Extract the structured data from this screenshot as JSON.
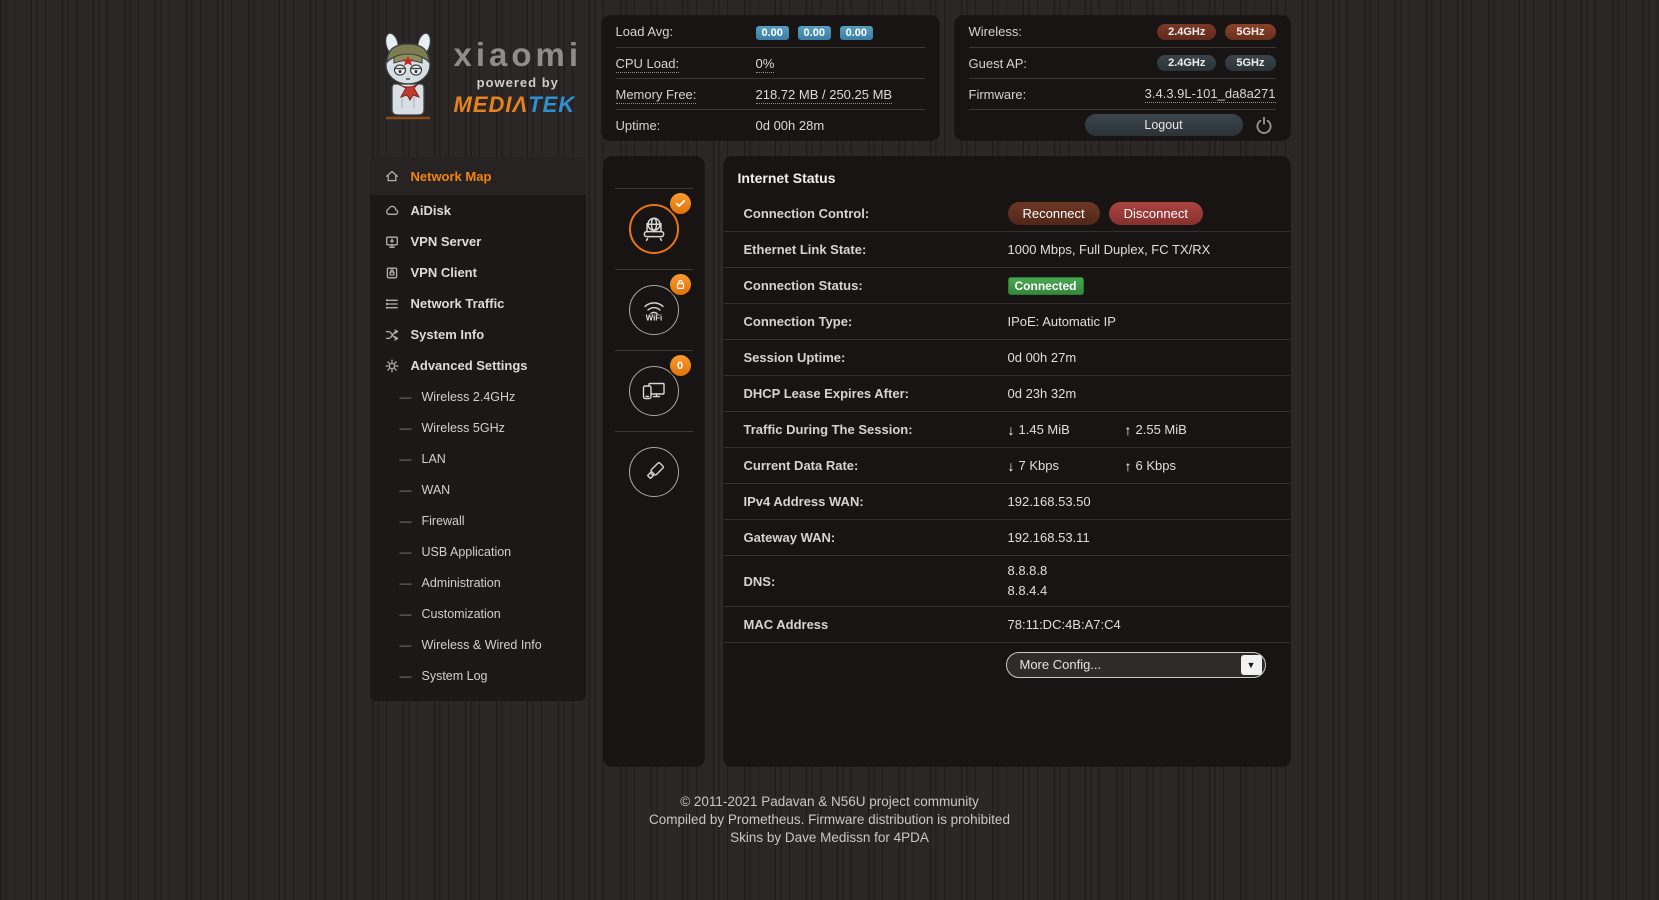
{
  "logo": {
    "brand": "xiaomi",
    "powered_by": "powered by",
    "chip_prefix": "MEDIΛ",
    "chip_suffix": "TEK"
  },
  "stats_panel": {
    "load_avg": {
      "label": "Load Avg:",
      "values": [
        "0.00",
        "0.00",
        "0.00"
      ]
    },
    "cpu_load": {
      "label": "CPU Load:",
      "value": "0%"
    },
    "memory_free": {
      "label": "Memory Free:",
      "value": "218.72 MB / 250.25 MB"
    },
    "uptime": {
      "label": "Uptime:",
      "value": "0d 00h 28m"
    }
  },
  "wireless_panel": {
    "wireless": {
      "label": "Wireless:",
      "badge_24": "2.4GHz",
      "badge_5": "5GHz"
    },
    "guest_ap": {
      "label": "Guest AP:",
      "badge_24": "2.4GHz",
      "badge_5": "5GHz"
    },
    "firmware": {
      "label": "Firmware:",
      "value": "3.4.3.9L-101_da8a271"
    },
    "logout_label": "Logout"
  },
  "sidebar": {
    "items": [
      {
        "label": "Network Map",
        "active": true
      },
      {
        "label": "AiDisk"
      },
      {
        "label": "VPN Server"
      },
      {
        "label": "VPN Client"
      },
      {
        "label": "Network Traffic"
      },
      {
        "label": "System Info"
      },
      {
        "label": "Advanced Settings"
      }
    ],
    "subitems": [
      "Wireless 2.4GHz",
      "Wireless 5GHz",
      "LAN",
      "WAN",
      "Firewall",
      "USB Application",
      "Administration",
      "Customization",
      "Wireless & Wired Info",
      "System Log"
    ]
  },
  "icon_rail": {
    "wifi_label": "WiFi",
    "clients_badge": "0"
  },
  "internet": {
    "title": "Internet Status",
    "rows": {
      "control": {
        "label": "Connection Control:",
        "reconnect": "Reconnect",
        "disconnect": "Disconnect"
      },
      "ethernet": {
        "label": "Ethernet Link State:",
        "value": "1000 Mbps, Full Duplex, FC TX/RX"
      },
      "status": {
        "label": "Connection Status:",
        "badge": "Connected"
      },
      "type": {
        "label": "Connection Type:",
        "value": "IPoE: Automatic IP"
      },
      "session": {
        "label": "Session Uptime:",
        "value": "0d 00h 27m"
      },
      "dhcp": {
        "label": "DHCP Lease Expires After:",
        "value": "0d 23h 32m"
      },
      "traffic": {
        "label": "Traffic During The Session:",
        "down": "1.45 MiB",
        "up": "2.55 MiB"
      },
      "rate": {
        "label": "Current Data Rate:",
        "down": "7 Kbps",
        "up": "6 Kbps"
      },
      "ipv4": {
        "label": "IPv4 Address WAN:",
        "value": "192.168.53.50"
      },
      "gateway": {
        "label": "Gateway WAN:",
        "value": "192.168.53.11"
      },
      "dns": {
        "label": "DNS:",
        "line1": "8.8.8.8",
        "line2": "8.8.4.4"
      },
      "mac": {
        "label": "MAC Address",
        "value": "78:11:DC:4B:A7:C4"
      }
    },
    "more_config": "More Config..."
  },
  "icons": {
    "down_arrow": "↓",
    "up_arrow": "↑",
    "dropdown_arrow": "▼"
  },
  "footer": {
    "lines": [
      "© 2011-2021 Padavan & N56U project community",
      "Compiled by Prometheus. Firmware distribution is prohibited",
      "Skins by Dave Medissn for 4PDA"
    ]
  },
  "colors": {
    "accent_orange": "#f28412",
    "badge_blue": "#4690b5",
    "connected_green": "#3f9a47",
    "reconnect_red": "#63301f",
    "disconnect_red": "#9e3b38",
    "wireless_badge_24": "#703323",
    "wireless_badge_5": "#7d3a25",
    "guest_badge": "#333c42"
  }
}
